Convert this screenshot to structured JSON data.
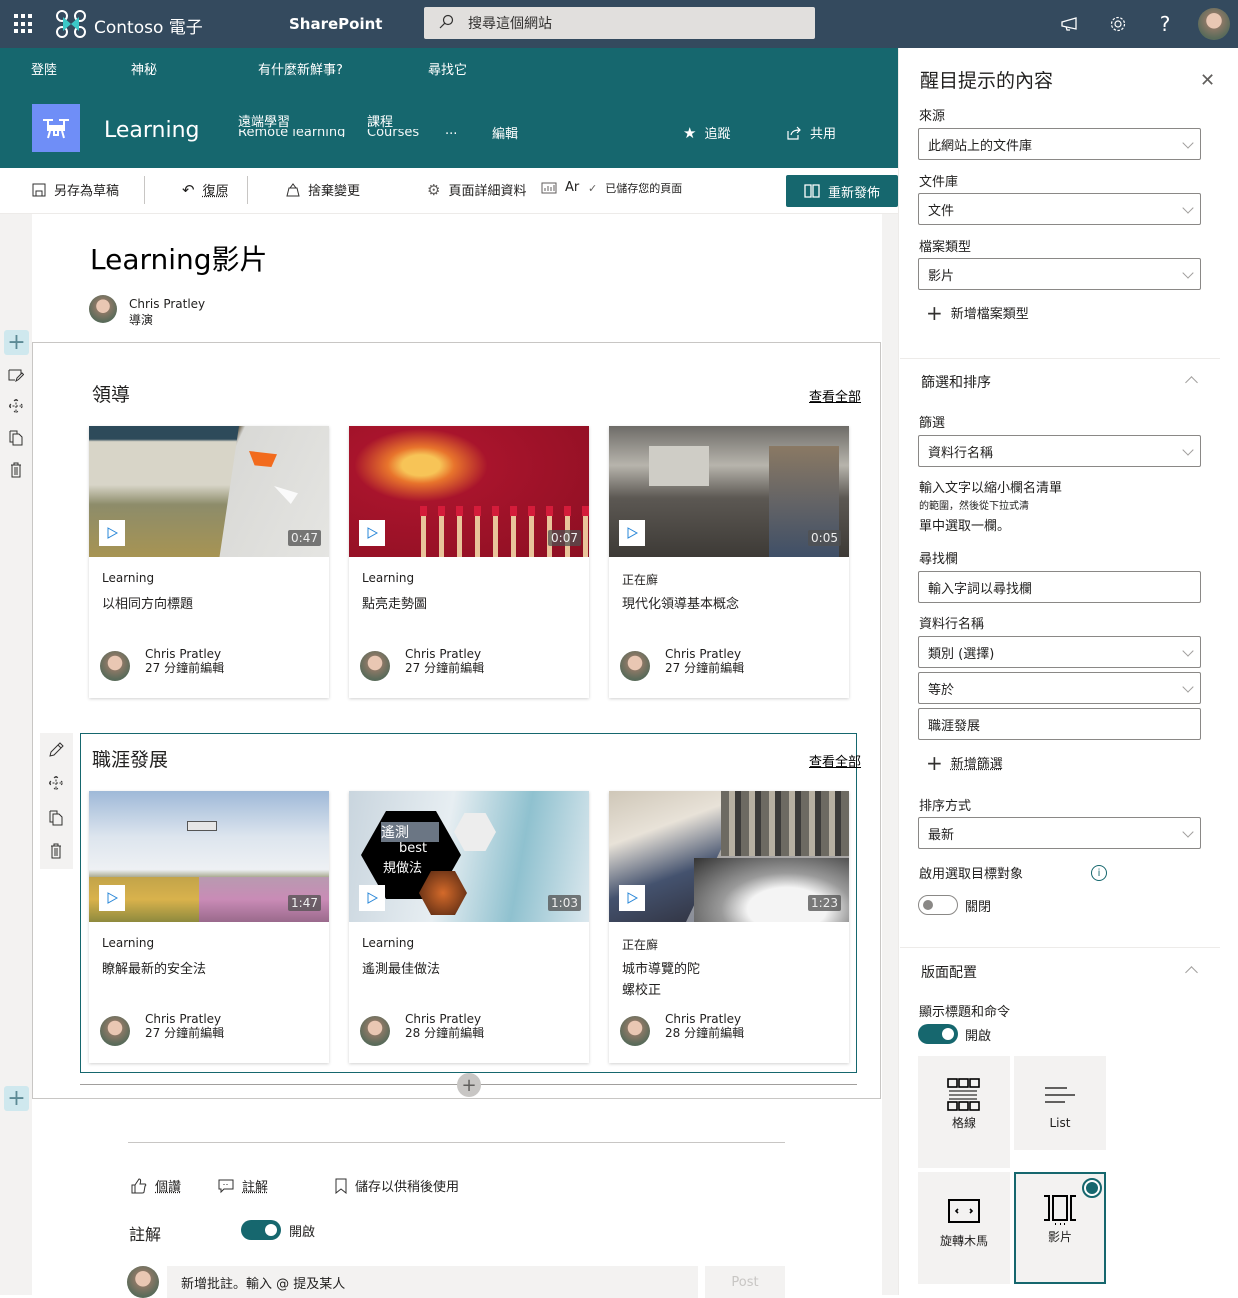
{
  "suite_bar": {
    "brand": "Contoso 電子",
    "app": "SharePoint",
    "search_placeholder": "搜尋這個網站",
    "icons": [
      "waffle-icon",
      "megaphone-icon",
      "gear-icon",
      "help-icon",
      "avatar"
    ]
  },
  "hub_nav": {
    "items": [
      "登陸",
      "神秘",
      "有什麼新鮮事?",
      "尋找它"
    ]
  },
  "site_header": {
    "site_name": "Learning",
    "nav": [
      {
        "label": "遠端學習",
        "sub": "Remote learning"
      },
      {
        "label": "課程",
        "sub": "Courses"
      },
      {
        "label": "..."
      },
      {
        "label": "編輯"
      }
    ],
    "follow": "追蹤",
    "share": "共用"
  },
  "command_bar": {
    "save_draft": "另存為草稿",
    "undo": "復原",
    "discard": "捨棄變更",
    "page_details": "頁面詳細資料",
    "analytics": "Ar",
    "saved_status": "已儲存您的頁面",
    "republish": "重新發佈"
  },
  "page": {
    "title": "Learning影片",
    "author": {
      "name": "Chris Pratley",
      "role": "導演"
    }
  },
  "sections": [
    {
      "heading": "領導",
      "see_all": "查看全部",
      "cards": [
        {
          "category": "Learning",
          "title": "以相同方向標題",
          "duration": "0:47",
          "author": "Chris Pratley",
          "edited": "27 分鐘前編輯"
        },
        {
          "category": "Learning",
          "title": "點亮走勢圖",
          "duration": "0:07",
          "author": "Chris Pratley",
          "edited": "27 分鐘前編輯"
        },
        {
          "category": "正在廯",
          "title": "現代化領導基本概念",
          "duration": "0:05",
          "author": "Chris Pratley",
          "edited": "27 分鐘前編輯"
        }
      ]
    },
    {
      "heading": "職涯發展",
      "see_all": "查看全部",
      "cards": [
        {
          "category": "Learning",
          "title": "瞭解最新的安全法",
          "duration": "1:47",
          "author": "Chris Pratley",
          "edited": "27 分鐘前編輯"
        },
        {
          "category": "Learning",
          "title": "遙測最佳做法",
          "duration": "1:03",
          "author": "Chris Pratley",
          "edited": "28 分鐘前編輯",
          "thumb_text": [
            "遙測",
            "best",
            "規做法"
          ]
        },
        {
          "category": "正在廯",
          "title": "城市導覽的陀螺校正",
          "duration": "1:23",
          "author": "Chris Pratley",
          "edited": "28 分鐘前編輯"
        }
      ]
    }
  ],
  "footer": {
    "like": "個讚",
    "comment": "註解",
    "save_later": "儲存以供稍後使用",
    "comments_label": "註解",
    "comments_toggle": "開啟",
    "comments_on": true,
    "comment_placeholder": "新增批註。輸入 @ 提及某人",
    "post": "Post"
  },
  "panel": {
    "title": "醒目提示的內容",
    "source_label": "來源",
    "source_value": "此網站上的文件庫",
    "library_label": "文件庫",
    "library_value": "文件",
    "filetype_label": "檔案類型",
    "filetype_value": "影片",
    "add_filetype": "新增檔案類型",
    "filter_sort_heading": "篩選和排序",
    "filter_label": "篩選",
    "filter_value": "資料行名稱",
    "filter_help": [
      "輸入文字以縮小欄名清單",
      "的範圍，然後從下拉式清",
      "單中選取一欄。"
    ],
    "find_column_label": "尋找欄",
    "find_column_placeholder": "輸入字詞以尋找欄",
    "column_name_label": "資料行名稱",
    "column_value": "類別 (選擇)",
    "operator_value": "等於",
    "filter_text": "職涯發展",
    "add_filter": "新增篩選",
    "sort_label": "排序方式",
    "sort_value": "最新",
    "audience_label": "啟用選取目標對象",
    "audience_toggle": "關閉",
    "audience_on": false,
    "layout_heading": "版面配置",
    "show_title_label": "顯示標題和命令",
    "show_title_toggle": "開啟",
    "show_title_on": true,
    "layouts": [
      {
        "label": "格線",
        "selected": false
      },
      {
        "label": "List",
        "selected": false
      },
      {
        "label": "旋轉木馬",
        "selected": false
      },
      {
        "label": "影片",
        "selected": true
      }
    ]
  },
  "colors": {
    "suite_bar": "#344a5e",
    "theme": "#16676e",
    "site_logo": "#6f8ef7"
  }
}
